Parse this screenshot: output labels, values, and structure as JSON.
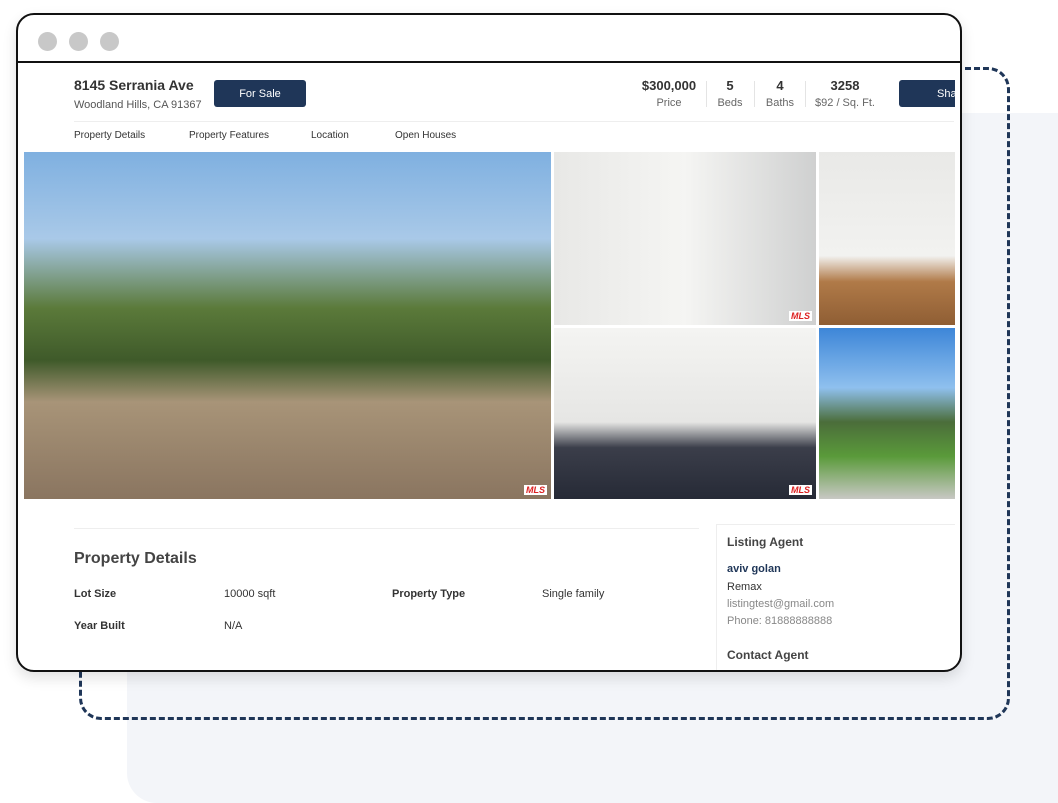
{
  "listing": {
    "address": "8145 Serrania Ave",
    "city": "Woodland Hills, CA 91367",
    "status_button": "For Sale",
    "share_button": "Sha"
  },
  "stats": [
    {
      "value": "$300,000",
      "label": "Price"
    },
    {
      "value": "5",
      "label": "Beds"
    },
    {
      "value": "4",
      "label": "Baths"
    },
    {
      "value": "3258",
      "label": "$92 / Sq. Ft."
    }
  ],
  "tabs": [
    "Property Details",
    "Property Features",
    "Location",
    "Open Houses"
  ],
  "photos": {
    "watermark": "MLS"
  },
  "details": {
    "title": "Property Details",
    "rows": [
      {
        "label": "Lot Size",
        "value": "10000 sqft"
      },
      {
        "label": "Property Type",
        "value": "Single family"
      },
      {
        "label": "Year Built",
        "value": "N/A"
      }
    ]
  },
  "agent": {
    "title": "Listing Agent",
    "name": "aviv golan",
    "company": "Remax",
    "email": "listingtest@gmail.com",
    "phone": "Phone: 81888888888",
    "contact_title": "Contact Agent"
  },
  "colors": {
    "brand": "#1f3658",
    "window_dots": "#c8c8c8"
  }
}
